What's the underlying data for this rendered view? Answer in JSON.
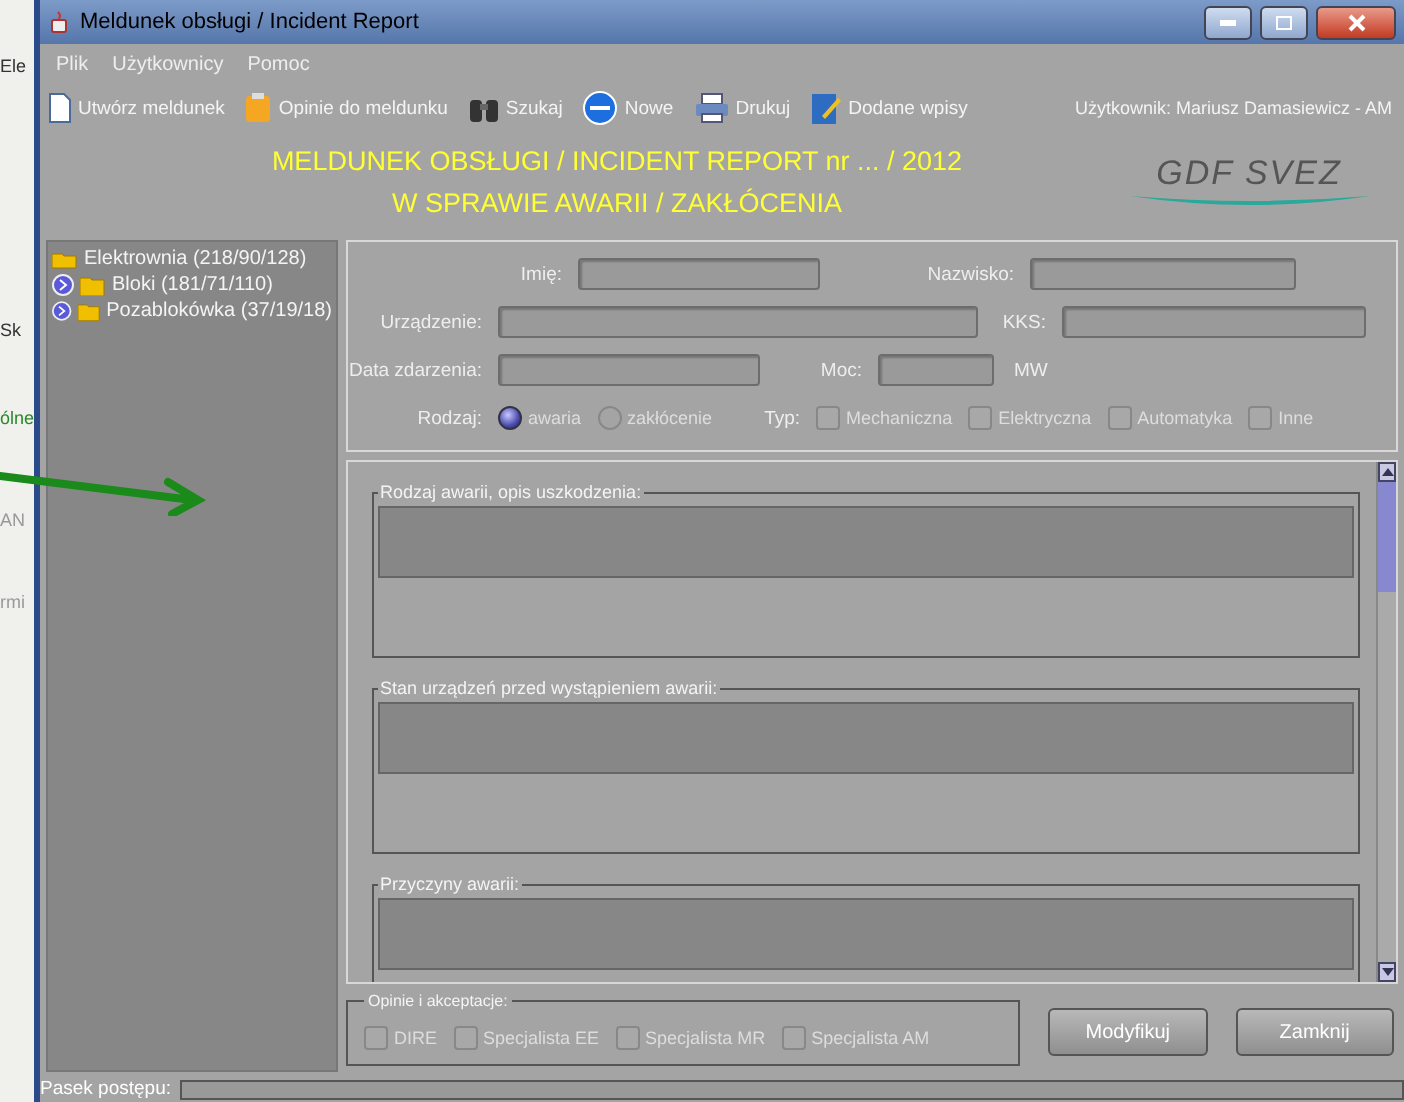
{
  "background_app": {
    "texts": [
      "Ele",
      "Sk",
      "ólne",
      "AN",
      "rmi"
    ]
  },
  "window": {
    "title": "Meldunek obsługi / Incident Report"
  },
  "menu": [
    "Plik",
    "Użytkownicy",
    "Pomoc"
  ],
  "toolbar": [
    {
      "label": "Utwórz meldunek",
      "kind": "document"
    },
    {
      "label": "Opinie do meldunku",
      "kind": "clipboard"
    },
    {
      "label": "Szukaj",
      "kind": "binoculars"
    },
    {
      "label": "Nowe",
      "kind": "new"
    },
    {
      "label": "Drukuj",
      "kind": "printer"
    },
    {
      "label": "Dodane wpisy",
      "kind": "edit"
    }
  ],
  "user": "Użytkownik: Mariusz Damasiewicz - AM",
  "header": {
    "line_1": "MELDUNEK OBSŁUGI / INCIDENT REPORT nr ... / 2012",
    "line_2": "W SPRAWIE AWARII / ZAKŁÓCENIA",
    "logo": "GDF SVEZ"
  },
  "tree": [
    {
      "label": "Elektrownia (218/90/128)",
      "expanded": true,
      "children": [
        {
          "label": "Bloki (181/71/110)",
          "expanded": false
        },
        {
          "label": "Pozablokówka (37/19/18)",
          "expanded": false
        }
      ]
    }
  ],
  "form": {
    "imie": "Imię:",
    "nazwisko": "Nazwisko:",
    "urzadzenie": "Urządzenie:",
    "kks": "KKS:",
    "data": "Data zdarzenia:",
    "moc": "Moc:",
    "unit": "MW",
    "rodzaj_label": "Rodzaj:",
    "rodzaj": [
      {
        "label": "awaria",
        "selected": true
      },
      {
        "label": "zakłócenie",
        "selected": false
      }
    ],
    "typ_label": "Typ:",
    "typ": [
      {
        "label": "Mechaniczna",
        "checked": false
      },
      {
        "label": "Elektryczna",
        "checked": false
      },
      {
        "label": "Automatyka",
        "checked": false
      },
      {
        "label": "Inne",
        "checked": false
      }
    ]
  },
  "sections": [
    "Rodzaj awarii, opis uszkodzenia:",
    "Stan urządzeń przed wystąpieniem awarii:",
    "Przyczyny awarii:"
  ],
  "opinions": {
    "title": "Opinie i akceptacje:",
    "items": [
      {
        "label": "DIRE",
        "checked": false
      },
      {
        "label": "Specjalista EE",
        "checked": false
      },
      {
        "label": "Specjalista MR",
        "checked": false
      },
      {
        "label": "Specjalista AM",
        "checked": false
      }
    ]
  },
  "buttons": [
    "Modyfikuj",
    "Zamknij"
  ],
  "status_bar": {
    "label": "Pasek postępu:",
    "level": 0
  }
}
